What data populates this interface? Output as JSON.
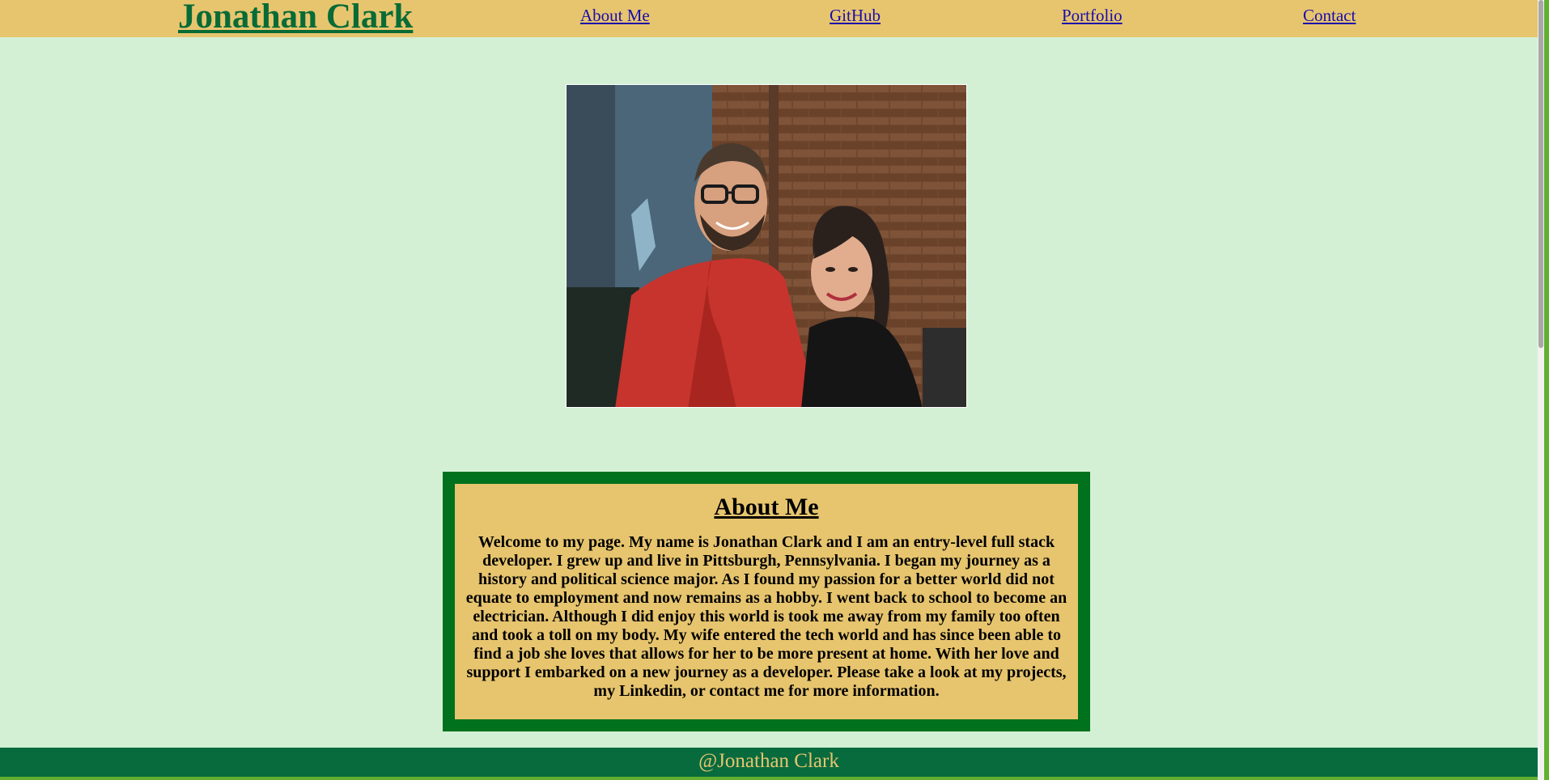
{
  "header": {
    "brand": "Jonathan Clark",
    "nav": [
      "About Me",
      "GitHub",
      "Portfolio",
      "Contact"
    ]
  },
  "photo": {
    "alt": "Jonathan Clark with his wife in front of a brick wall"
  },
  "about": {
    "title": "About Me",
    "text": "Welcome to my page. My name is Jonathan Clark and I am an entry-level full stack developer. I grew up and live in Pittsburgh, Pennsylvania. I began my journey as a history and political science major. As I found my passion for a better world did not equate to employment and now remains as a hobby. I went back to school to become an electrician. Although I did enjoy this world is took me away from my family too often and took a toll on my body. My wife entered the tech world and has since been able to find a job she loves that allows for her to be more present at home. With her love and support I embarked on a new journey as a developer. Please take a look at my projects, my Linkedin, or contact me for more information."
  },
  "footer": {
    "text": "@Jonathan Clark"
  },
  "colors": {
    "page_background": "#d3f0d5",
    "header_background": "#e7c56e",
    "brand_green": "#086b36",
    "about_border": "#00711c",
    "footer_background": "#086b3e",
    "footer_text": "#e7c56e",
    "link": "#1a0dab"
  }
}
